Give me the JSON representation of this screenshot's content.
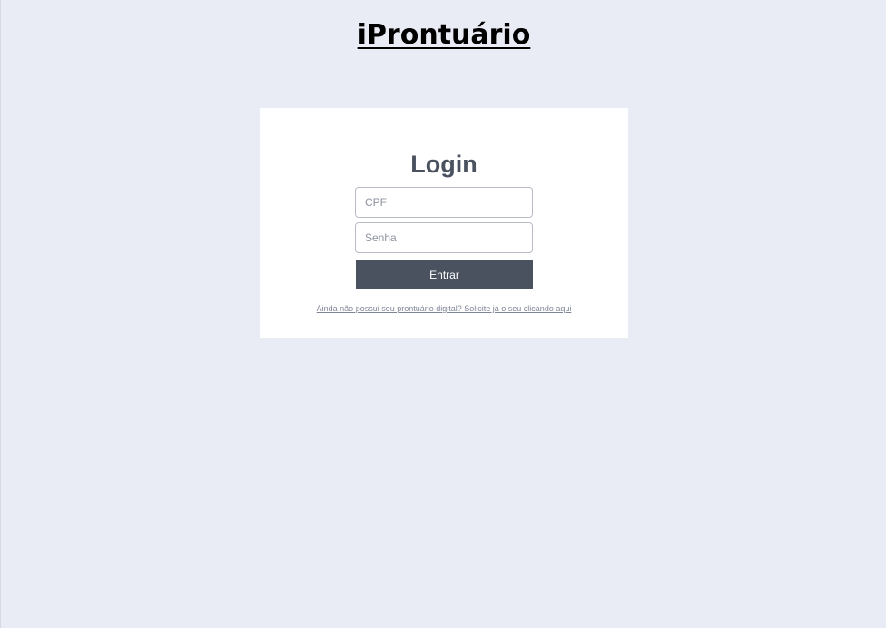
{
  "app": {
    "title": "iProntuário"
  },
  "login": {
    "heading": "Login",
    "cpf_placeholder": "CPF",
    "cpf_value": "",
    "senha_placeholder": "Senha",
    "senha_value": "",
    "submit_label": "Entrar",
    "signup_text": "Ainda não possui seu prontuário digital? Solicite já o seu clicando aqui"
  },
  "colors": {
    "background": "#e9ecf4",
    "card": "#ffffff",
    "primary": "#4a5260",
    "link": "#7d8594"
  }
}
